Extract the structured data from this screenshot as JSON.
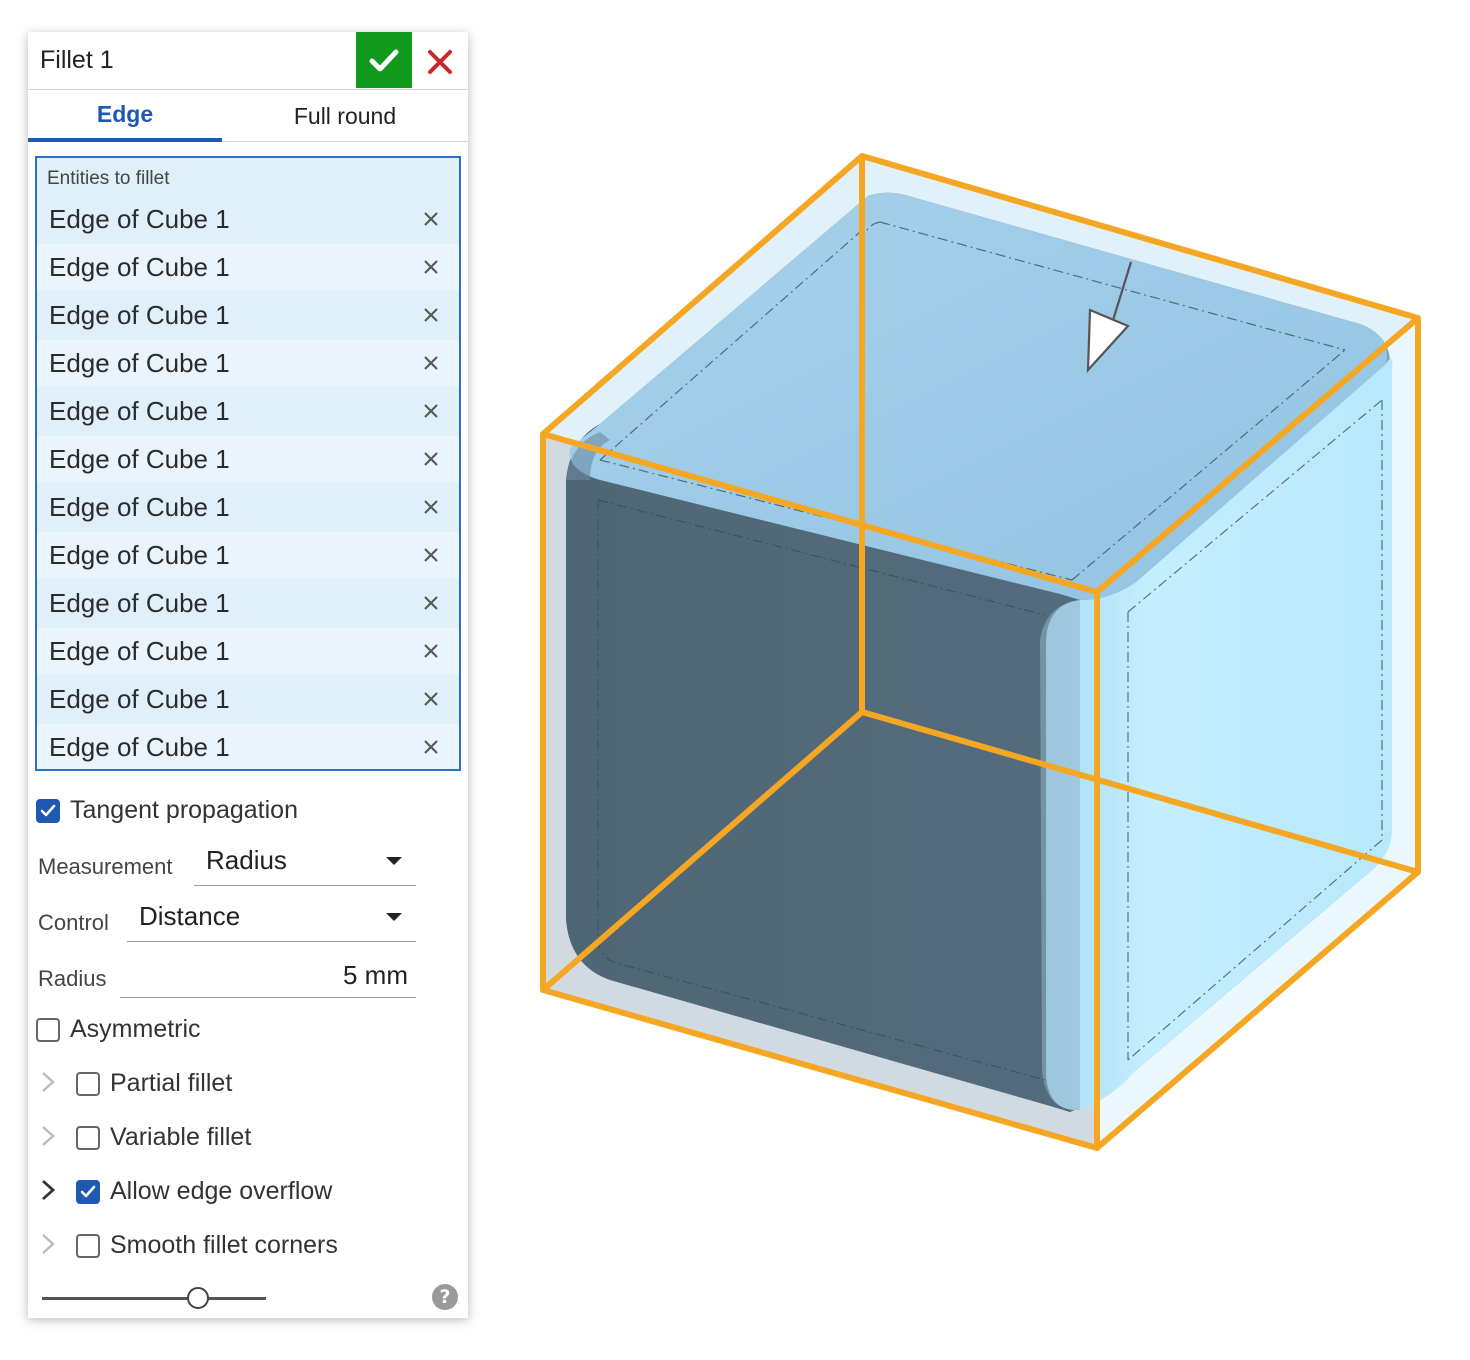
{
  "dialog": {
    "title": "Fillet 1",
    "tabs": [
      {
        "label": "Edge",
        "active": true
      },
      {
        "label": "Full round",
        "active": false
      }
    ],
    "entities": {
      "label": "Entities to fillet",
      "items": [
        "Edge of Cube 1",
        "Edge of Cube 1",
        "Edge of Cube 1",
        "Edge of Cube 1",
        "Edge of Cube 1",
        "Edge of Cube 1",
        "Edge of Cube 1",
        "Edge of Cube 1",
        "Edge of Cube 1",
        "Edge of Cube 1",
        "Edge of Cube 1",
        "Edge of Cube 1"
      ]
    },
    "tangent_propagation": {
      "label": "Tangent propagation",
      "checked": true
    },
    "measurement": {
      "label": "Measurement",
      "value": "Radius"
    },
    "control": {
      "label": "Control",
      "value": "Distance"
    },
    "radius": {
      "label": "Radius",
      "value": "5 mm"
    },
    "asymmetric": {
      "label": "Asymmetric",
      "checked": false
    },
    "options": [
      {
        "label": "Partial fillet",
        "checked": false,
        "chevron": "collapsed"
      },
      {
        "label": "Variable fillet",
        "checked": false,
        "chevron": "collapsed"
      },
      {
        "label": "Allow edge overflow",
        "checked": true,
        "chevron": "collapsed"
      },
      {
        "label": "Smooth fillet corners",
        "checked": false,
        "chevron": "collapsed"
      }
    ],
    "preview_slider": {
      "value": 0.7
    },
    "help_icon": "?"
  },
  "colors": {
    "accept": "#109a1c",
    "cancel": "#c62828",
    "accent": "#1e58b3",
    "selection_box": "#f5a623",
    "cube_top": "#9ecbe6",
    "cube_front": "#536a7a",
    "cube_right": "#bfeeff"
  }
}
